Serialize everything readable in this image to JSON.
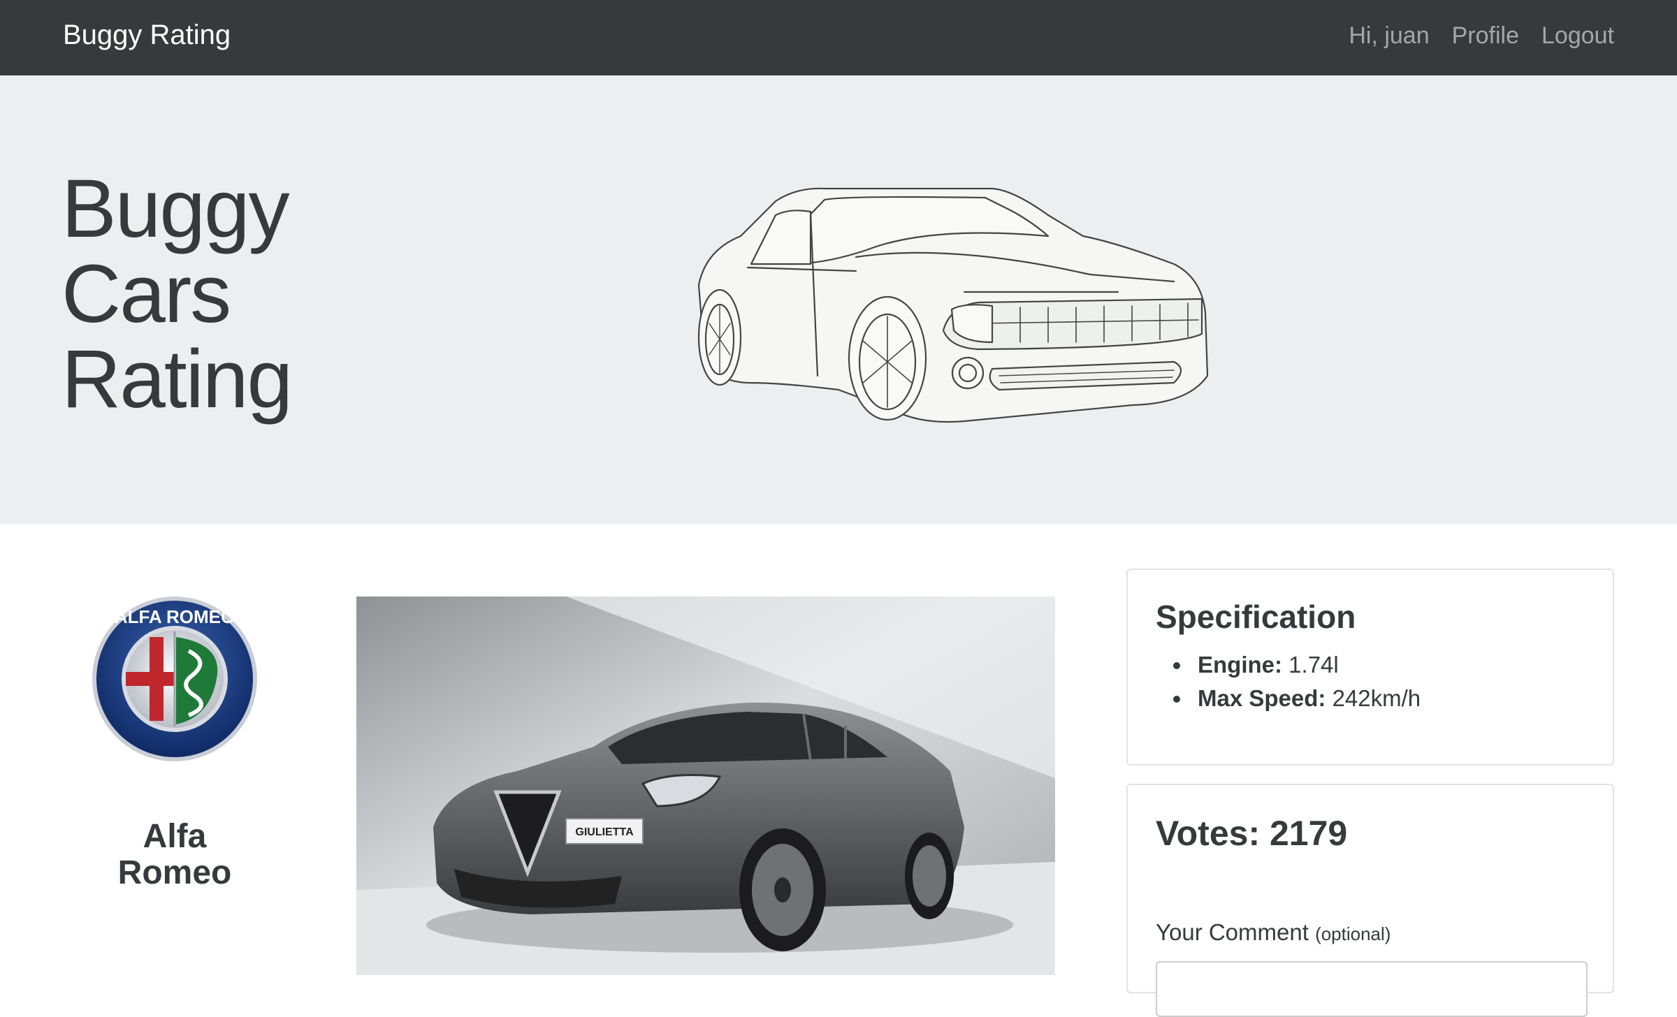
{
  "navbar": {
    "brand": "Buggy Rating",
    "greeting": "Hi, juan",
    "profile_link": "Profile",
    "logout_link": "Logout"
  },
  "jumbotron": {
    "title_line1": "Buggy",
    "title_line2": "Cars",
    "title_line3": "Rating"
  },
  "make": {
    "logo_text": "ALFA ROMEO",
    "name_line1": "Alfa",
    "name_line2": "Romeo"
  },
  "model": {
    "plate_text": "GIULIETTA"
  },
  "specification": {
    "heading": "Specification",
    "engine_label": "Engine:",
    "engine_value": "1.74l",
    "speed_label": "Max Speed:",
    "speed_value": "242km/h"
  },
  "votes": {
    "heading": "Votes: 2179",
    "comment_label": "Your Comment",
    "comment_hint": "(optional)",
    "comment_value": ""
  },
  "colors": {
    "navbar_bg": "#373a3c",
    "jumbotron_bg": "#eceeef",
    "text": "#373a3c"
  }
}
